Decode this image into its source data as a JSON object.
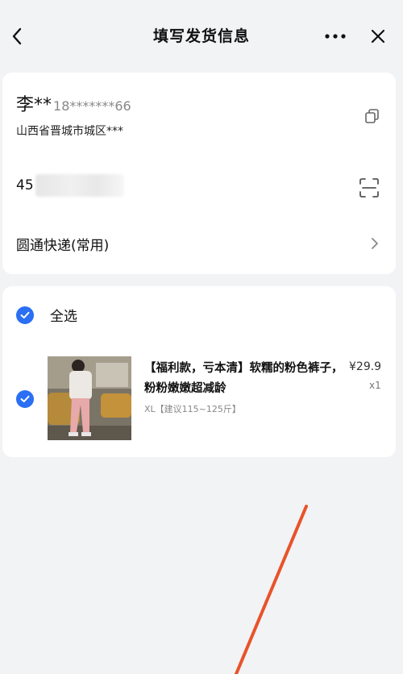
{
  "header": {
    "title": "填写发货信息",
    "more_label": "···",
    "back_icon": "chevron-left-icon",
    "close_icon": "close-icon"
  },
  "address": {
    "name": "李**",
    "phone": "18*******66",
    "region": "山西省晋城市城区***"
  },
  "tracking": {
    "number_prefix": "45"
  },
  "courier": {
    "label": "圆通快递(常用)"
  },
  "goods": {
    "select_all": "全选",
    "item": {
      "title": "【福利款，亏本清】软糯的粉色裤子，粉粉嫩嫩超减龄",
      "price": "¥29.9",
      "qty": "x1",
      "spec": "XL【建议115~125斤】"
    }
  },
  "colors": {
    "accent": "#2a6ff4",
    "annotation": "#e8532a",
    "background": "#f2f3f5"
  }
}
